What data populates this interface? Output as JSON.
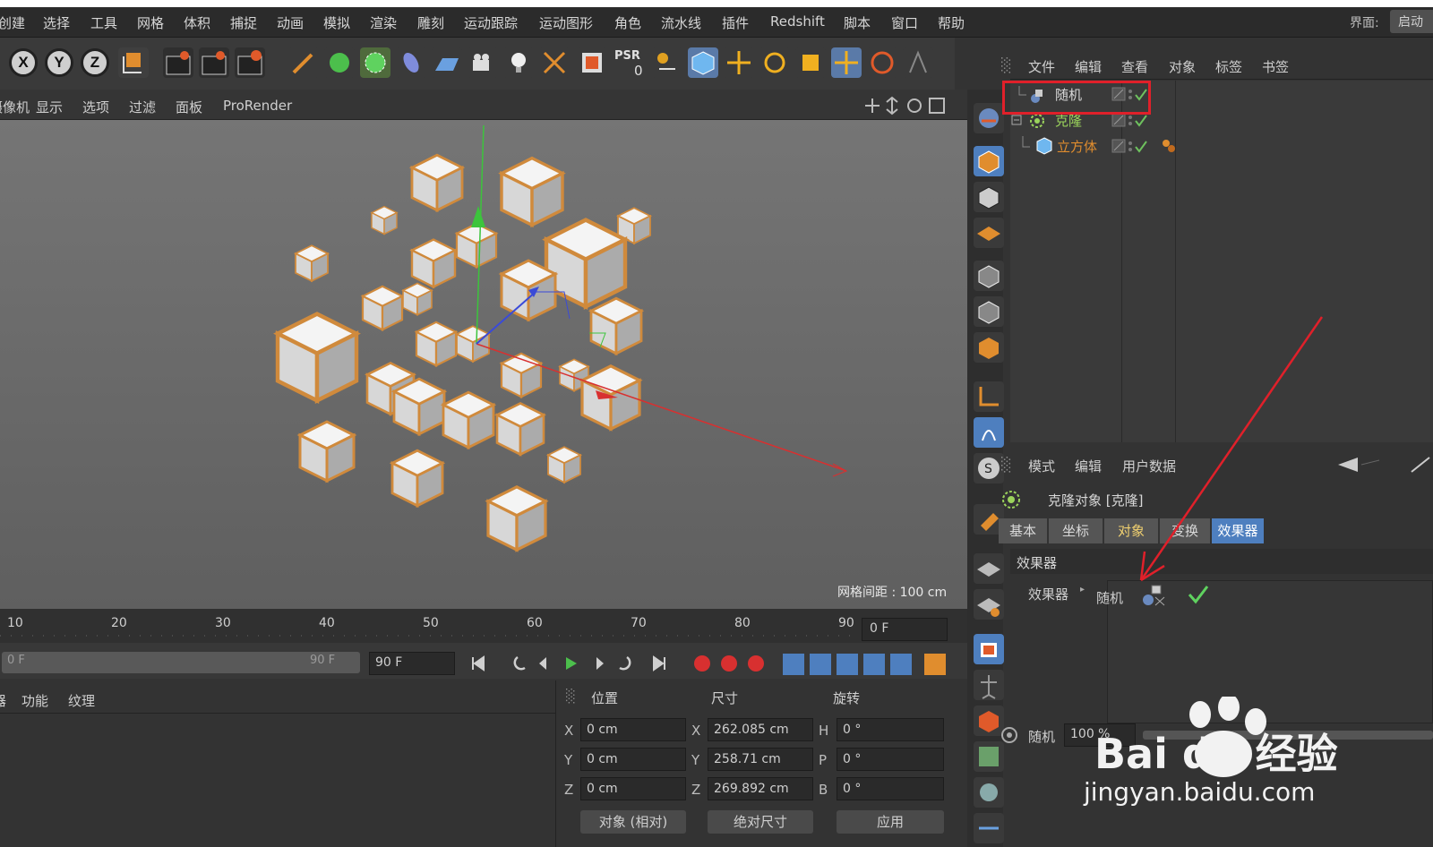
{
  "menubar": {
    "items": [
      "创建",
      "选择",
      "工具",
      "网格",
      "体积",
      "捕捉",
      "动画",
      "模拟",
      "渲染",
      "雕刻",
      "运动跟踪",
      "运动图形",
      "角色",
      "流水线",
      "插件",
      "Redshift",
      "脚本",
      "窗口",
      "帮助"
    ],
    "layout_label": "界面:",
    "layout_value": "启动"
  },
  "toolbar": {
    "axis_x": "X",
    "axis_y": "Y",
    "axis_z": "Z",
    "psr_label": "PSR",
    "psr_value": "0"
  },
  "viewport": {
    "menu": [
      "摄像机",
      "显示",
      "选项",
      "过滤",
      "面板",
      "ProRender"
    ],
    "grid_spacing": "网格间距 : 100 cm"
  },
  "object_manager": {
    "menu": [
      "文件",
      "编辑",
      "查看",
      "对象",
      "标签",
      "书签"
    ],
    "objects": [
      {
        "name": "随机",
        "color": "#d8d8d8"
      },
      {
        "name": "克隆",
        "color": "#9bd35c"
      },
      {
        "name": "立方体",
        "color": "#e08d2e"
      }
    ]
  },
  "attribute_manager": {
    "menu": [
      "模式",
      "编辑",
      "用户数据"
    ],
    "title": "克隆对象 [克隆]",
    "tabs": [
      "基本",
      "坐标",
      "对象",
      "变换",
      "效果器"
    ],
    "section": "效果器",
    "effector_label": "效果器",
    "effector_item": "随机",
    "radio_label": "随机",
    "radio_value": "100 %"
  },
  "timeline": {
    "ticks": [
      "10",
      "20",
      "30",
      "40",
      "50",
      "60",
      "70",
      "80",
      "90"
    ],
    "current_frame": "0 F",
    "range_start": "0 F",
    "range_end": "90 F",
    "end_frame": "90 F"
  },
  "coords": {
    "tabs": [
      "功能",
      "纹理"
    ],
    "headers": [
      "位置",
      "尺寸",
      "旋转"
    ],
    "pos": {
      "x": "0 cm",
      "y": "0 cm",
      "z": "0 cm"
    },
    "size": {
      "x": "262.085 cm",
      "y": "258.71 cm",
      "z": "269.892 cm"
    },
    "rot": {
      "h": "0 °",
      "p": "0 °",
      "b": "0 °"
    },
    "mode_select": "对象 (相对)",
    "size_select": "绝对尺寸",
    "apply": "应用"
  },
  "watermark": {
    "text": "Bai du 经验",
    "url": "jingyan.baidu.com"
  },
  "colors": {
    "accent_blue": "#4e7fbf",
    "highlight_red": "#e0202a",
    "selection_orange": "#d08a3c"
  }
}
